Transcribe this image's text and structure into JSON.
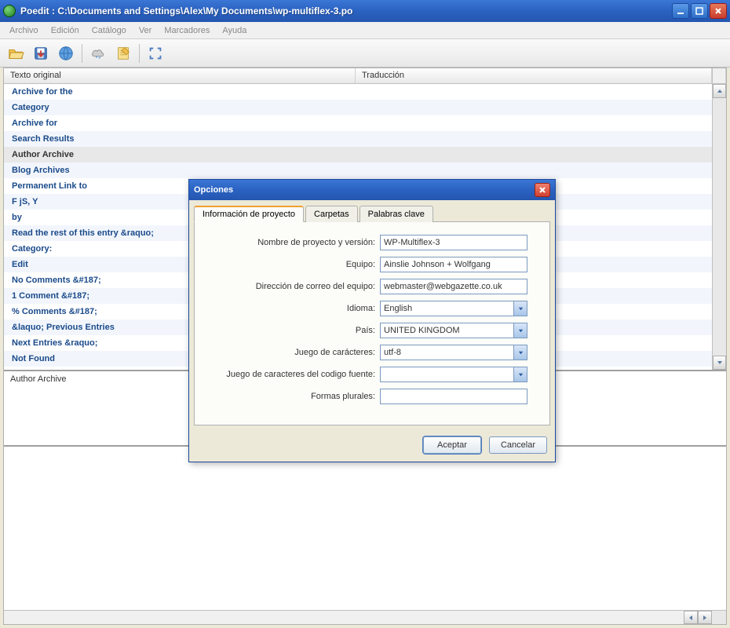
{
  "titlebar": {
    "title": "Poedit : C:\\Documents and Settings\\Alex\\My Documents\\wp-multiflex-3.po"
  },
  "menu": {
    "items": [
      "Archivo",
      "Edición",
      "Catálogo",
      "Ver",
      "Marcadores",
      "Ayuda"
    ]
  },
  "grid": {
    "header_original": "Texto original",
    "header_translation": "Traducción",
    "rows": [
      {
        "original": "Archive for the",
        "translation": ""
      },
      {
        "original": "Category",
        "translation": ""
      },
      {
        "original": "Archive for",
        "translation": ""
      },
      {
        "original": "Search Results",
        "translation": ""
      },
      {
        "original": "Author Archive",
        "translation": "",
        "selected": true
      },
      {
        "original": "Blog Archives",
        "translation": ""
      },
      {
        "original": "Permanent Link to",
        "translation": ""
      },
      {
        "original": "F jS, Y",
        "translation": ""
      },
      {
        "original": "by",
        "translation": ""
      },
      {
        "original": "Read the rest of this entry &raquo;",
        "translation": ""
      },
      {
        "original": "Category:",
        "translation": ""
      },
      {
        "original": "Edit",
        "translation": ""
      },
      {
        "original": "No Comments &#187;",
        "translation": ""
      },
      {
        "original": "1 Comment &#187;",
        "translation": ""
      },
      {
        "original": "% Comments &#187;",
        "translation": ""
      },
      {
        "original": "&laquo; Previous Entries",
        "translation": ""
      },
      {
        "original": "Next Entries &raquo;",
        "translation": ""
      },
      {
        "original": "Not Found",
        "translation": ""
      }
    ]
  },
  "detail": {
    "original": "Author Archive",
    "translation": ""
  },
  "dialog": {
    "title": "Opciones",
    "tabs": {
      "project": "Información de proyecto",
      "folders": "Carpetas",
      "keywords": "Palabras clave"
    },
    "labels": {
      "project_name": "Nombre de proyecto y versión:",
      "team": "Equipo:",
      "team_email": "Dirección de correo del equipo:",
      "language": "Idioma:",
      "country": "País:",
      "charset": "Juego de carácteres:",
      "source_charset": "Juego de caracteres del codigo fuente:",
      "plural_forms": "Formas plurales:"
    },
    "values": {
      "project_name": "WP-Multiflex-3",
      "team": "Ainslie Johnson + Wolfgang",
      "team_email": "webmaster@webgazette.co.uk",
      "language": "English",
      "country": "UNITED KINGDOM",
      "charset": "utf-8",
      "source_charset": "",
      "plural_forms": ""
    },
    "buttons": {
      "accept": "Aceptar",
      "cancel": "Cancelar"
    }
  }
}
